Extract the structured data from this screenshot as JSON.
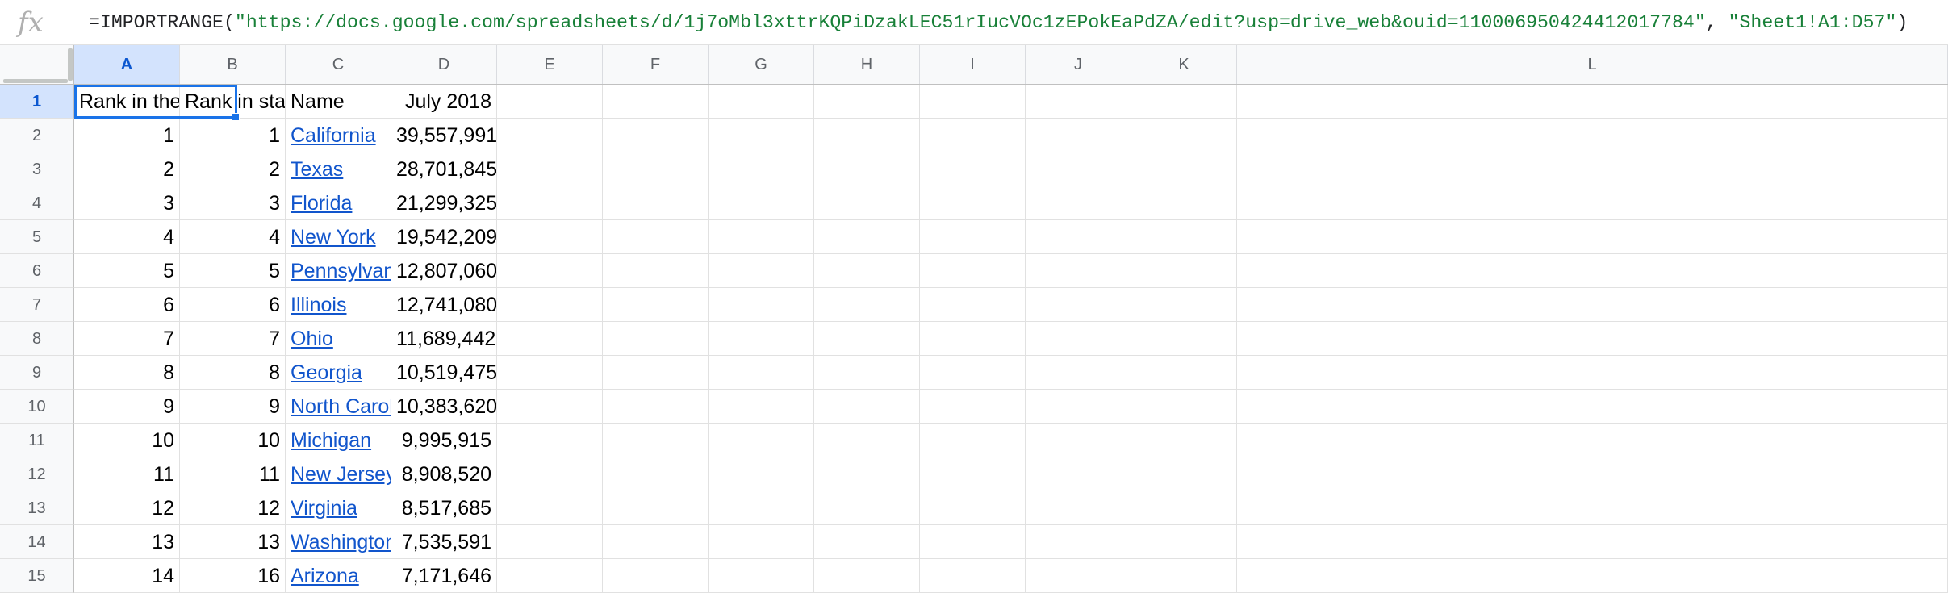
{
  "formula_bar": {
    "icon": "fx-icon",
    "prefix": "=IMPORTRANGE(",
    "url_arg": "\"https://docs.google.com/spreadsheets/d/1j7oMbl3xttrKQPiDzakLEC51rIucVOc1zEPokEaPdZA/edit?usp=drive_web&ouid=110006950424412017784\"",
    "separator": ", ",
    "range_arg": "\"Sheet1!A1:D57\"",
    "suffix": ")"
  },
  "columns": [
    "A",
    "B",
    "C",
    "D",
    "E",
    "F",
    "G",
    "H",
    "I",
    "J",
    "K",
    "L"
  ],
  "active_column": "A",
  "active_row": "1",
  "rows": [
    {
      "n": "1",
      "a": "Rank in the fifty states",
      "b": "Rank in states & territories",
      "c": "Name",
      "d": "July 2018",
      "header": true
    },
    {
      "n": "2",
      "a": "1",
      "b": "1",
      "c": "California",
      "d": "39,557,991"
    },
    {
      "n": "3",
      "a": "2",
      "b": "2",
      "c": "Texas",
      "d": "28,701,845"
    },
    {
      "n": "4",
      "a": "3",
      "b": "3",
      "c": "Florida",
      "d": "21,299,325"
    },
    {
      "n": "5",
      "a": "4",
      "b": "4",
      "c": "New York",
      "d": "19,542,209"
    },
    {
      "n": "6",
      "a": "5",
      "b": "5",
      "c": "Pennsylvania",
      "d": "12,807,060"
    },
    {
      "n": "7",
      "a": "6",
      "b": "6",
      "c": "Illinois",
      "d": "12,741,080"
    },
    {
      "n": "8",
      "a": "7",
      "b": "7",
      "c": "Ohio",
      "d": "11,689,442"
    },
    {
      "n": "9",
      "a": "8",
      "b": "8",
      "c": "Georgia",
      "d": "10,519,475"
    },
    {
      "n": "10",
      "a": "9",
      "b": "9",
      "c": "North Carolina",
      "d": "10,383,620"
    },
    {
      "n": "11",
      "a": "10",
      "b": "10",
      "c": "Michigan",
      "d": "9,995,915"
    },
    {
      "n": "12",
      "a": "11",
      "b": "11",
      "c": "New Jersey",
      "d": "8,908,520"
    },
    {
      "n": "13",
      "a": "12",
      "b": "12",
      "c": "Virginia",
      "d": "8,517,685"
    },
    {
      "n": "14",
      "a": "13",
      "b": "13",
      "c": "Washington",
      "d": "7,535,591"
    },
    {
      "n": "15",
      "a": "14",
      "b": "16",
      "c": "Arizona",
      "d": "7,171,646"
    }
  ],
  "colors": {
    "link": "#1155cc",
    "selection": "#1a73e8",
    "formula_string": "#188038",
    "active_header_bg": "#d3e3fd"
  }
}
